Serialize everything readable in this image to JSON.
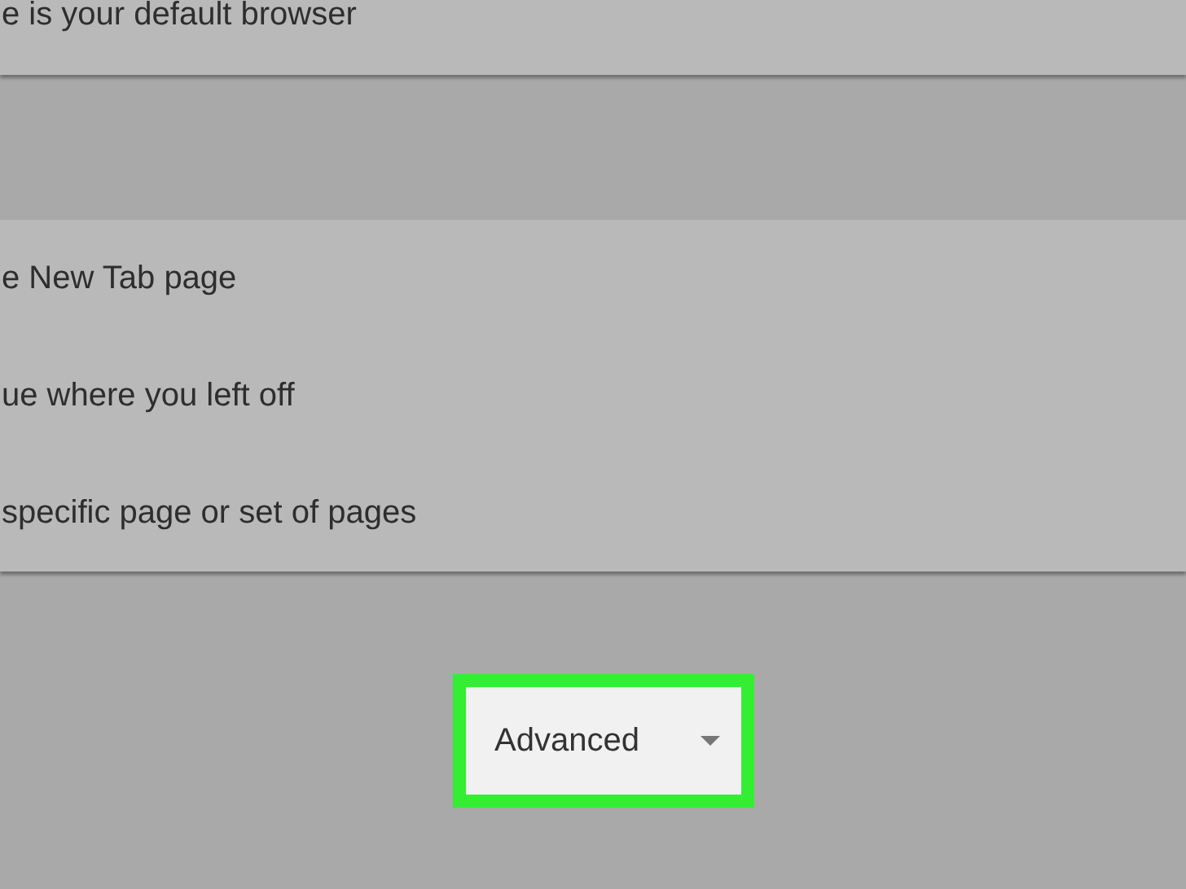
{
  "default_browser_card": {
    "text": "e is your default browser"
  },
  "startup_options": [
    {
      "label": "e New Tab page"
    },
    {
      "label": "ue where you left off"
    },
    {
      "label": "specific page or set of pages"
    }
  ],
  "advanced_button": {
    "label": "Advanced",
    "highlighted": true
  }
}
